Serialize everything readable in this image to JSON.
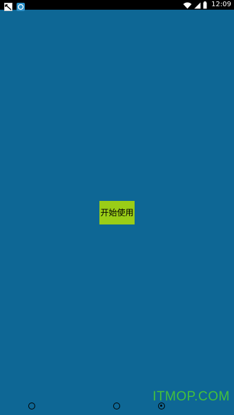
{
  "status_bar": {
    "time": "12:09",
    "left_icons": [
      "notification-icon",
      "app-icon"
    ],
    "right_icons": [
      "wifi-icon",
      "signal-icon",
      "battery-icon"
    ]
  },
  "main": {
    "start_button_label": "开始使用",
    "background_color": "#0e6795",
    "button_color": "#9acd17"
  },
  "pager": {
    "count": 3,
    "active_index": 2
  },
  "watermark": {
    "text": "ITMOP.COM"
  }
}
